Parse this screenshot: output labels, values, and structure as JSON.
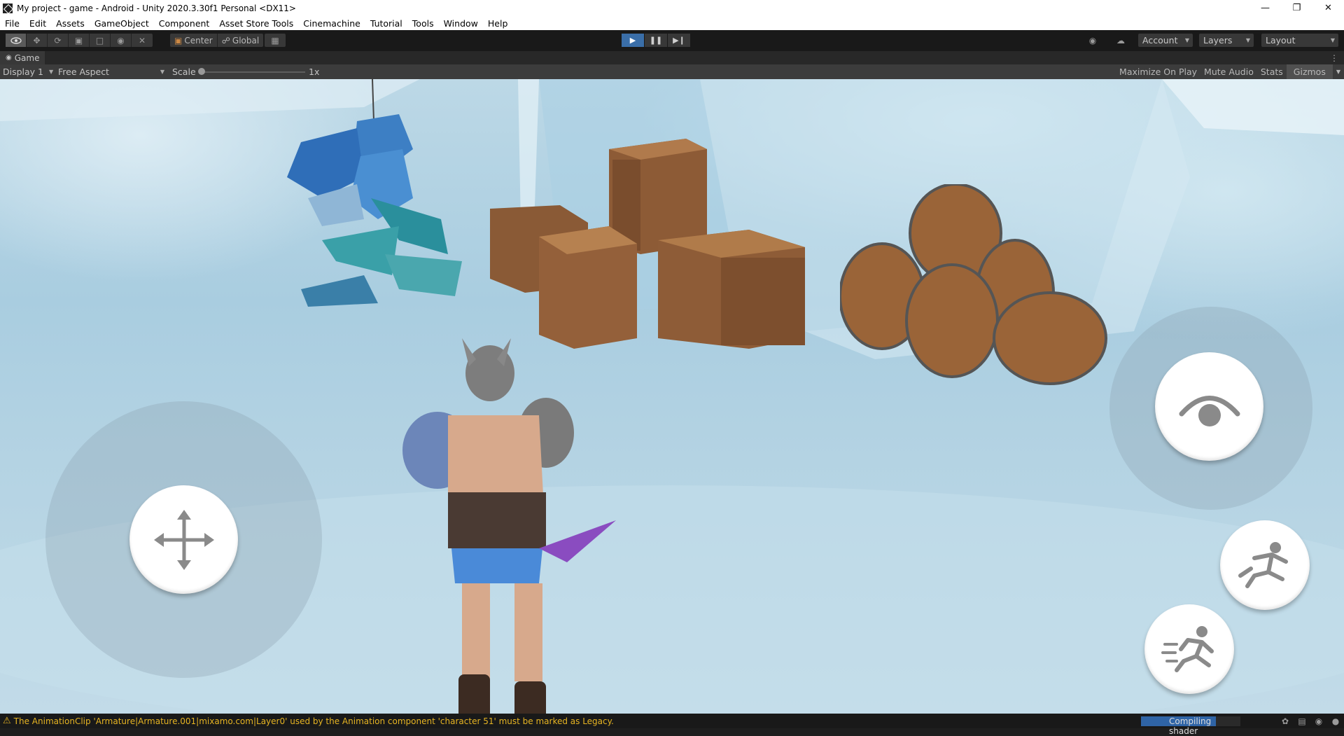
{
  "titlebar": {
    "title": "My project - game - Android - Unity 2020.3.30f1 Personal <DX11>"
  },
  "menu": [
    "File",
    "Edit",
    "Assets",
    "GameObject",
    "Component",
    "Asset Store Tools",
    "Cinemachine",
    "Tutorial",
    "Tools",
    "Window",
    "Help"
  ],
  "toolbar": {
    "pivot_label": "Center",
    "space_label": "Global",
    "account_label": "Account",
    "layers_label": "Layers",
    "layout_label": "Layout"
  },
  "game_tab": {
    "label": "Game"
  },
  "game_bar": {
    "display": "Display 1",
    "aspect": "Free Aspect",
    "scale_label": "Scale",
    "scale_value": "1x",
    "maximize": "Maximize On Play",
    "mute": "Mute Audio",
    "stats": "Stats",
    "gizmos": "Gizmos"
  },
  "status": {
    "message": "The AnimationClip 'Armature|Armature.001|mixamo.com|Layer0' used by the Animation component 'character 51' must be marked as Legacy.",
    "progress_label": "Compiling shader",
    "progress_fraction": 0.75
  },
  "colors": {
    "accent": "#3a6ea8",
    "warning": "#e6b422",
    "sky": "#b4d3e3"
  }
}
